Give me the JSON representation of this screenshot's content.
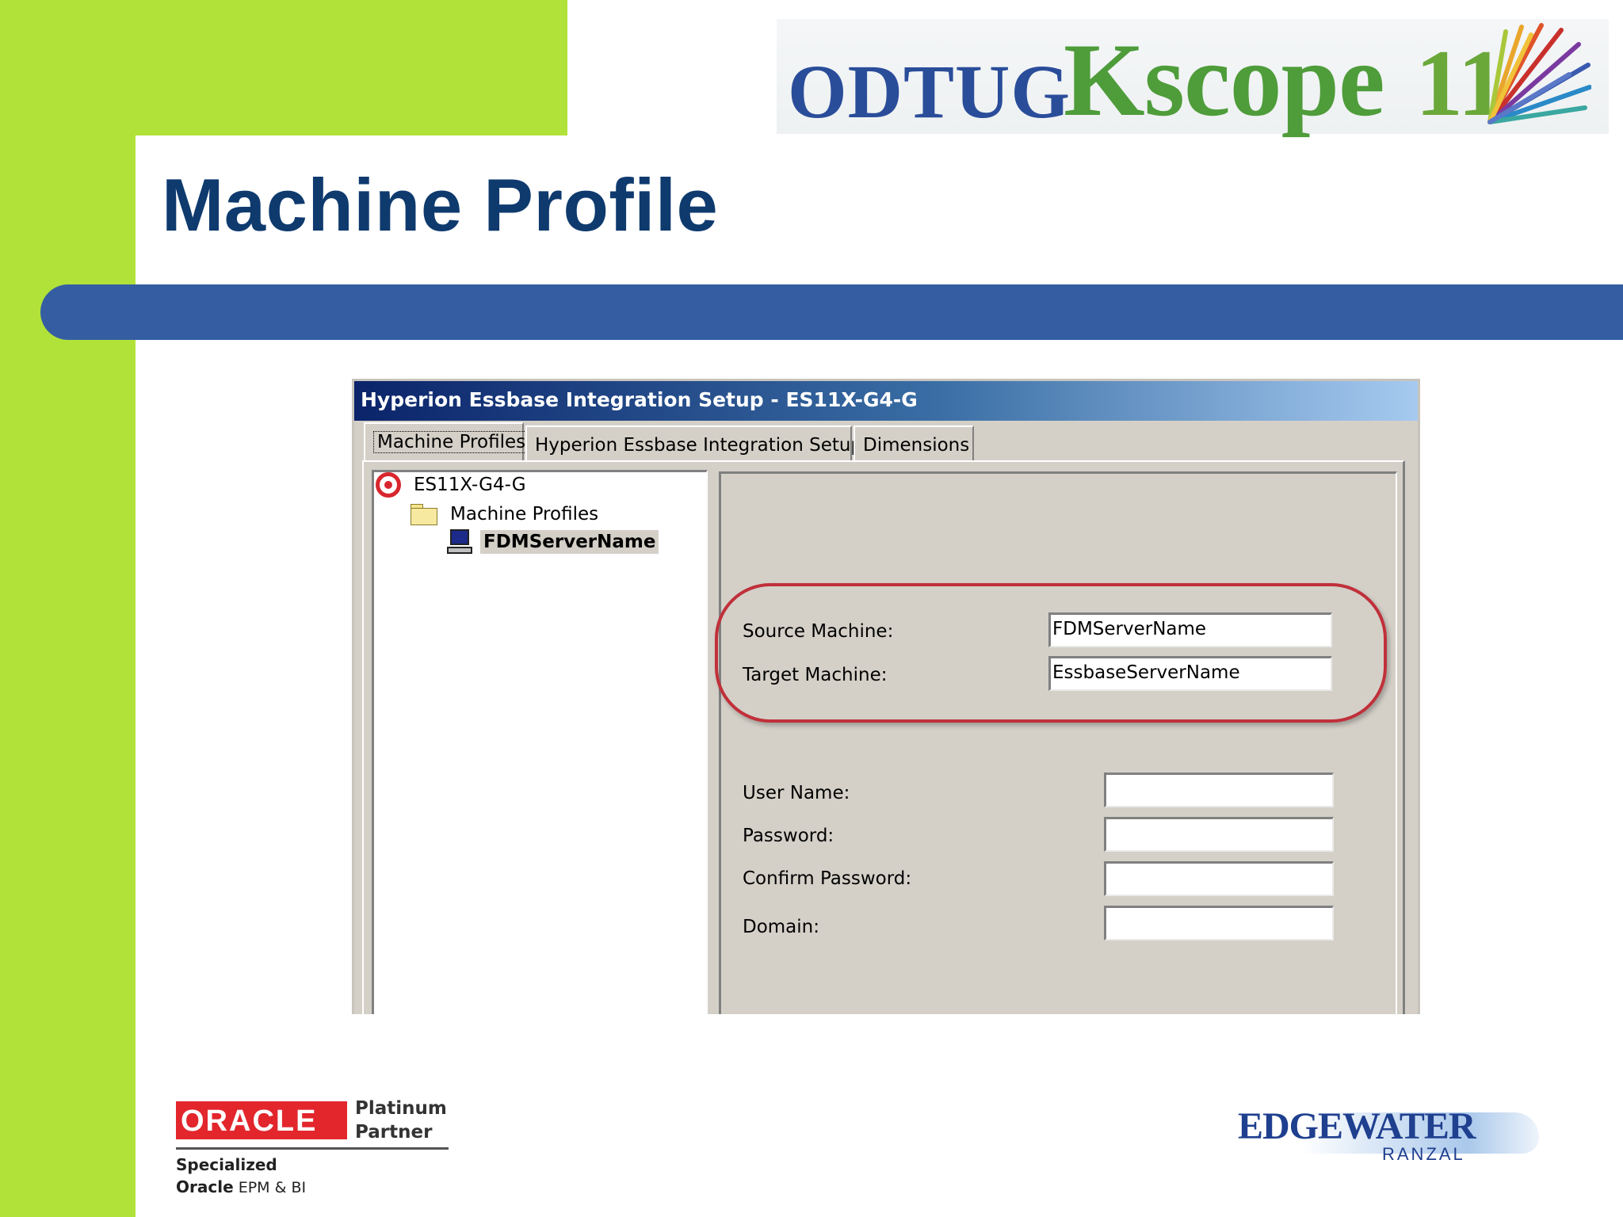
{
  "slide": {
    "title": "Machine Profile"
  },
  "conference_logo": {
    "org": "ODTUG",
    "event": "Kscope",
    "year": "11",
    "colors": {
      "org": "#2a4d9a",
      "event": "#4e9c3a"
    }
  },
  "dialog": {
    "title": "Hyperion Essbase Integration Setup - ES11X-G4-G",
    "tabs": [
      {
        "label": "Machine Profiles",
        "active": true
      },
      {
        "label": "Hyperion Essbase Integration Setup",
        "active": false
      },
      {
        "label": "Dimensions",
        "active": false
      }
    ],
    "tree": {
      "root": {
        "label": "ES11X-G4-G",
        "icon": "target-icon"
      },
      "folder": {
        "label": "Machine Profiles",
        "icon": "folder-icon"
      },
      "item": {
        "label": "FDMServerName",
        "icon": "computer-icon",
        "selected": true
      }
    },
    "form": {
      "source_machine": {
        "label": "Source Machine:",
        "value": "FDMServerName"
      },
      "target_machine": {
        "label": "Target Machine:",
        "value": "EssbaseServerName"
      },
      "user_name": {
        "label": "User Name:",
        "value": ""
      },
      "password": {
        "label": "Password:",
        "value": ""
      },
      "confirm_password": {
        "label": "Confirm Password:",
        "value": ""
      },
      "domain": {
        "label": "Domain:",
        "value": ""
      }
    },
    "highlight_color": "#c0303a"
  },
  "footer": {
    "partner": {
      "brand": "ORACLE",
      "tier_line1": "Platinum",
      "tier_line2": "Partner",
      "specialized": "Specialized",
      "spec_brand": "Oracle",
      "spec_area": "EPM & BI"
    },
    "company": {
      "name": "EDGEWATER",
      "sub": "RANZAL"
    }
  },
  "colors": {
    "accent_green": "#b1e23a",
    "bar_blue": "#355ea2",
    "title_navy": "#0e3a6e"
  }
}
